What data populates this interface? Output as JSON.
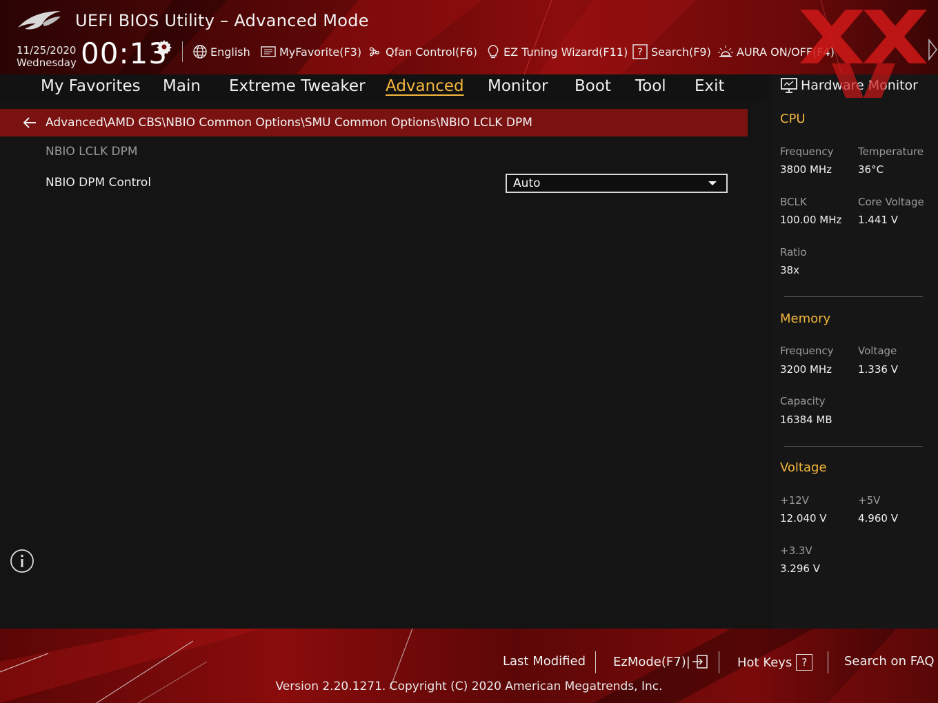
{
  "header": {
    "title": "UEFI BIOS Utility – Advanced Mode",
    "date": "11/25/2020",
    "weekday": "Wednesday",
    "time": "00:13",
    "tools": [
      {
        "label": "English",
        "icon": "globe-icon"
      },
      {
        "label": "MyFavorite(F3)",
        "icon": "favorite-list-icon"
      },
      {
        "label": "Qfan Control(F6)",
        "icon": "fan-icon"
      },
      {
        "label": "EZ Tuning Wizard(F11)",
        "icon": "lightbulb-icon"
      },
      {
        "label": "Search(F9)",
        "icon": "question-box-icon"
      },
      {
        "label": "AURA ON/OFF(F4)",
        "icon": "aura-light-icon"
      }
    ]
  },
  "tabs": [
    "My Favorites",
    "Main",
    "Extreme Tweaker",
    "Advanced",
    "Monitor",
    "Boot",
    "Tool",
    "Exit"
  ],
  "active_tab": "Advanced",
  "main": {
    "breadcrumb": "Advanced\\AMD CBS\\NBIO Common Options\\SMU Common Options\\NBIO LCLK DPM",
    "section_label": "NBIO LCLK DPM",
    "options": [
      {
        "label": "NBIO DPM Control",
        "value": "Auto"
      }
    ]
  },
  "hardware_monitor": {
    "title": "Hardware Monitor",
    "cpu": {
      "heading": "CPU",
      "frequency_label": "Frequency",
      "frequency": "3800 MHz",
      "temperature_label": "Temperature",
      "temperature": "36°C",
      "bclk_label": "BCLK",
      "bclk": "100.00 MHz",
      "core_voltage_label": "Core Voltage",
      "core_voltage": "1.441 V",
      "ratio_label": "Ratio",
      "ratio": "38x"
    },
    "memory": {
      "heading": "Memory",
      "frequency_label": "Frequency",
      "frequency": "3200 MHz",
      "voltage_label": "Voltage",
      "voltage": "1.336 V",
      "capacity_label": "Capacity",
      "capacity": "16384 MB"
    },
    "voltage": {
      "heading": "Voltage",
      "v12_label": "+12V",
      "v12": "12.040 V",
      "v5_label": "+5V",
      "v5": "4.960 V",
      "v33_label": "+3.3V",
      "v33": "3.296 V"
    }
  },
  "footer": {
    "last_modified": "Last Modified",
    "ezmode": "EzMode(F7)|",
    "hot_keys": "Hot Keys",
    "hot_keys_key": "?",
    "search_faq": "Search on FAQ",
    "version": "Version 2.20.1271. Copyright (C) 2020 American Megatrends, Inc."
  },
  "colors": {
    "accent": "#f5b83d",
    "breadcrumb_bg": "#7a1212",
    "panel_bg": "#141414",
    "header_red": "#8a0c0c"
  }
}
